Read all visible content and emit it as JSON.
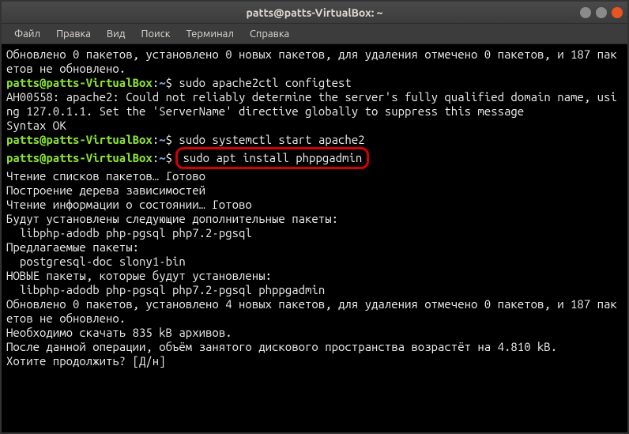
{
  "titlebar": {
    "title": "patts@patts-VirtualBox: ~"
  },
  "menubar": {
    "items": [
      "Файл",
      "Правка",
      "Вид",
      "Поиск",
      "Терминал",
      "Справка"
    ]
  },
  "prompt": {
    "userhost": "patts@patts-VirtualBox",
    "sep1": ":",
    "path": "~",
    "sep2": "$"
  },
  "terminal": {
    "line01": "Обновлено 0 пакетов, установлено 0 новых пакетов, для удаления отмечено 0 пакетов, и 187 пакетов не обновлено.",
    "cmd1": " sudo apache2ctl configtest",
    "line03": "AH00558: apache2: Could not reliably determine the server's fully qualified domain name, using 127.0.1.1. Set the 'ServerName' directive globally to suppress this message",
    "line04": "Syntax OK",
    "cmd2": " sudo systemctl start apache2",
    "cmd3": "sudo apt install phppgadmin",
    "line07": "Чтение списков пакетов… Готово",
    "line08": "Построение дерева зависимостей       ",
    "line09": "Чтение информации о состоянии… Готово",
    "line10": "Будут установлены следующие дополнительные пакеты:",
    "line11": "  libphp-adodb php-pgsql php7.2-pgsql",
    "line12": "Предлагаемые пакеты:",
    "line13": "  postgresql-doc slony1-bin",
    "line14": "НОВЫЕ пакеты, которые будут установлены:",
    "line15": "  libphp-adodb php-pgsql php7.2-pgsql phppgadmin",
    "line16": "Обновлено 0 пакетов, установлено 4 новых пакетов, для удаления отмечено 0 пакетов, и 187 пакетов не обновлено.",
    "line17": "Необходимо скачать 835 kB архивов.",
    "line18": "После данной операции, объём занятого дискового пространства возрастёт на 4.810 kB.",
    "line19": "Хотите продолжить? [Д/н] "
  }
}
